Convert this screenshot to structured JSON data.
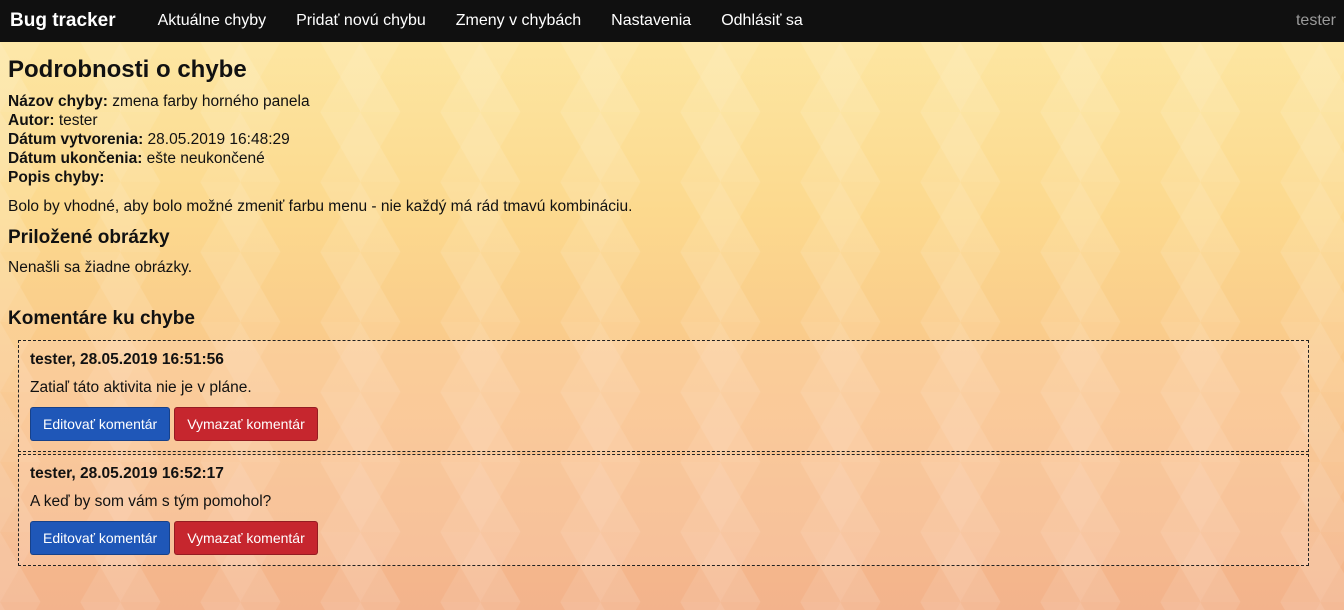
{
  "nav": {
    "brand": "Bug tracker",
    "items": [
      "Aktuálne chyby",
      "Pridať novú chybu",
      "Zmeny v chybách",
      "Nastavenia",
      "Odhlásiť sa"
    ],
    "user": "tester"
  },
  "detail": {
    "title": "Podrobnosti o chybe",
    "fields": [
      {
        "label": "Názov chyby:",
        "value": "zmena farby horného panela"
      },
      {
        "label": "Autor:",
        "value": "tester"
      },
      {
        "label": "Dátum vytvorenia:",
        "value": "28.05.2019 16:48:29"
      },
      {
        "label": "Dátum ukončenia:",
        "value": "ešte neukončené"
      },
      {
        "label": "Popis chyby:",
        "value": ""
      }
    ],
    "description": "Bolo by vhodné, aby bolo možné zmeniť farbu menu - nie každý má rád tmavú kombináciu."
  },
  "images": {
    "heading": "Priložené obrázky",
    "empty_text": "Nenašli sa žiadne obrázky."
  },
  "comments": {
    "heading": "Komentáre ku chybe",
    "items": [
      {
        "header": "tester, 28.05.2019 16:51:56",
        "text": "Zatiaľ táto aktivita nie je v pláne.",
        "edit_label": "Editovať komentár",
        "delete_label": "Vymazať komentár"
      },
      {
        "header": "tester, 28.05.2019 16:52:17",
        "text": "A keď by som vám s tým pomohol?",
        "edit_label": "Editovať komentár",
        "delete_label": "Vymazať komentár"
      }
    ]
  },
  "colors": {
    "navbar": "#101010",
    "edit_button": "#1f57b8",
    "delete_button": "#c6262e"
  }
}
